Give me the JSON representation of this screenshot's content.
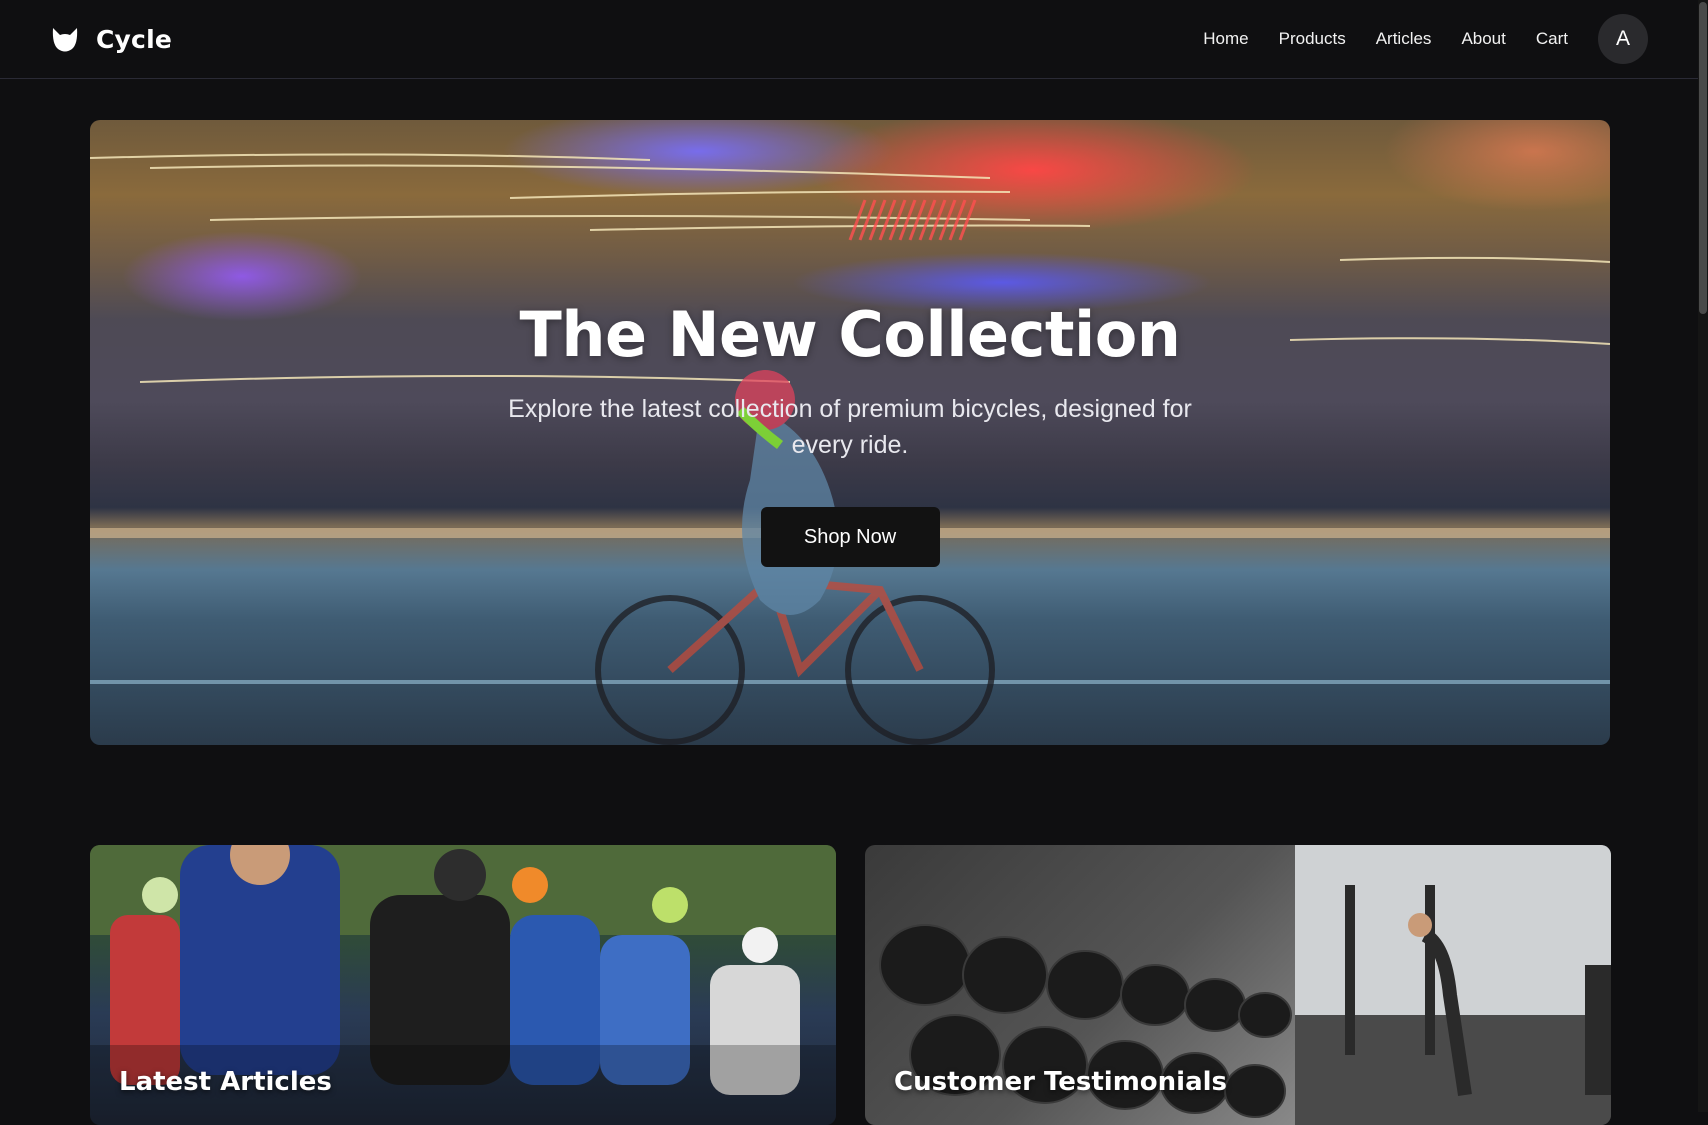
{
  "brand": {
    "name": "Cycle",
    "logo_icon": "cat-ears-icon"
  },
  "nav": {
    "items": [
      {
        "label": "Home"
      },
      {
        "label": "Products"
      },
      {
        "label": "Articles"
      },
      {
        "label": "About"
      },
      {
        "label": "Cart"
      }
    ],
    "avatar_initial": "A"
  },
  "hero": {
    "title": "The New Collection",
    "subtitle": "Explore the latest collection of premium bicycles, designed for every ride.",
    "button_label": "Shop Now"
  },
  "cards": [
    {
      "title": "Latest Articles"
    },
    {
      "title": "Customer Testimonials"
    }
  ],
  "colors": {
    "background": "#0f0f11",
    "button": "#121212",
    "text": "#ffffff"
  }
}
